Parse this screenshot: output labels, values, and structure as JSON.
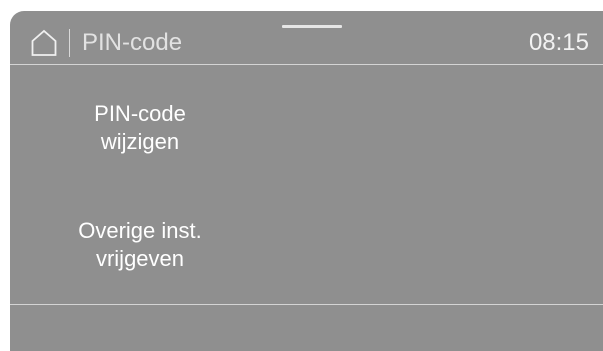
{
  "header": {
    "title": "PIN-code",
    "time": "08:15"
  },
  "menu": {
    "items": [
      {
        "line1": "PIN-code",
        "line2": "wijzigen"
      },
      {
        "line1": "Overige inst.",
        "line2": "vrijgeven"
      }
    ]
  },
  "colors": {
    "screen_background": "#8f8f8f",
    "text": "#ffffff",
    "rule": "#d4d4d4"
  },
  "icons": {
    "home": "home-icon"
  }
}
